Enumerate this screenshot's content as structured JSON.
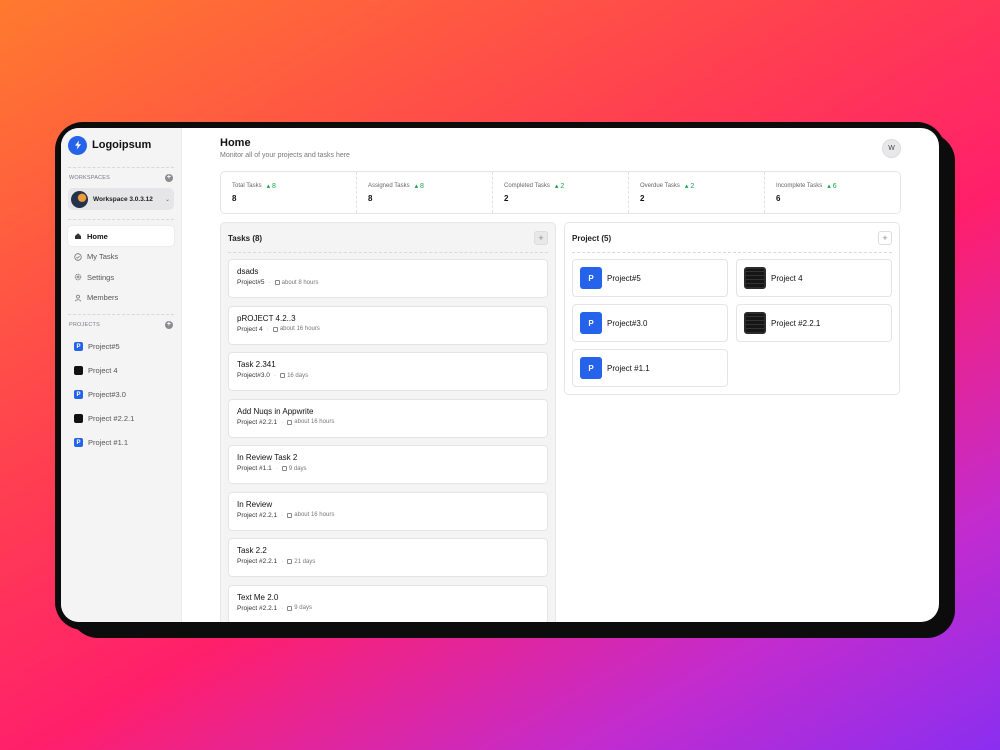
{
  "brand": {
    "name": "Logoipsum"
  },
  "sidebar": {
    "workspaces_heading": "WORKSPACES",
    "workspace": {
      "name": "Workspace 3.0.3.12"
    },
    "nav": [
      {
        "label": "Home",
        "icon": "home-icon"
      },
      {
        "label": "My Tasks",
        "icon": "check-circle-icon"
      },
      {
        "label": "Settings",
        "icon": "gear-icon"
      },
      {
        "label": "Members",
        "icon": "user-icon"
      }
    ],
    "projects_heading": "PROJECTS",
    "projects": [
      {
        "label": "Project#5",
        "badge": "P",
        "style": "blue"
      },
      {
        "label": "Project 4",
        "badge": "",
        "style": "dark"
      },
      {
        "label": "Project#3.0",
        "badge": "P",
        "style": "blue"
      },
      {
        "label": "Project #2.2.1",
        "badge": "",
        "style": "dark"
      },
      {
        "label": "Project #1.1",
        "badge": "P",
        "style": "blue"
      }
    ]
  },
  "header": {
    "title": "Home",
    "subtitle": "Monitor all of your projects and tasks here",
    "user_initial": "W"
  },
  "stats": [
    {
      "label": "Total Tasks",
      "delta": "8",
      "value": "8"
    },
    {
      "label": "Assigned Tasks",
      "delta": "8",
      "value": "8"
    },
    {
      "label": "Completed Tasks",
      "delta": "2",
      "value": "2"
    },
    {
      "label": "Overdue Tasks",
      "delta": "2",
      "value": "2"
    },
    {
      "label": "Incomplete Tasks",
      "delta": "6",
      "value": "6"
    }
  ],
  "tasks_panel": {
    "title": "Tasks (8)",
    "items": [
      {
        "name": "dsads",
        "project": "Project#5",
        "due": "about 8 hours"
      },
      {
        "name": "pROJECT 4.2..3",
        "project": "Project 4",
        "due": "about 16 hours"
      },
      {
        "name": "Task 2.341",
        "project": "Project#3.0",
        "due": "16 days"
      },
      {
        "name": "Add Nuqs in Appwrite",
        "project": "Project #2.2.1",
        "due": "about 16 hours"
      },
      {
        "name": "In Review Task 2",
        "project": "Project #1.1",
        "due": "9 days"
      },
      {
        "name": "In Review",
        "project": "Project #2.2.1",
        "due": "about 16 hours"
      },
      {
        "name": "Task 2.2",
        "project": "Project #2.2.1",
        "due": "21 days"
      },
      {
        "name": "Text Me 2.0",
        "project": "Project #2.2.1",
        "due": "9 days"
      }
    ]
  },
  "projects_panel": {
    "title": "Project (5)",
    "items": [
      {
        "name": "Project#5",
        "badge": "P",
        "style": "blue"
      },
      {
        "name": "Project 4",
        "badge": "",
        "style": "dark"
      },
      {
        "name": "Project#3.0",
        "badge": "P",
        "style": "blue"
      },
      {
        "name": "Project #2.2.1",
        "badge": "",
        "style": "dark"
      },
      {
        "name": "Project #1.1",
        "badge": "P",
        "style": "blue"
      }
    ]
  },
  "colors": {
    "accent": "#2563eb",
    "positive": "#16a34a"
  }
}
